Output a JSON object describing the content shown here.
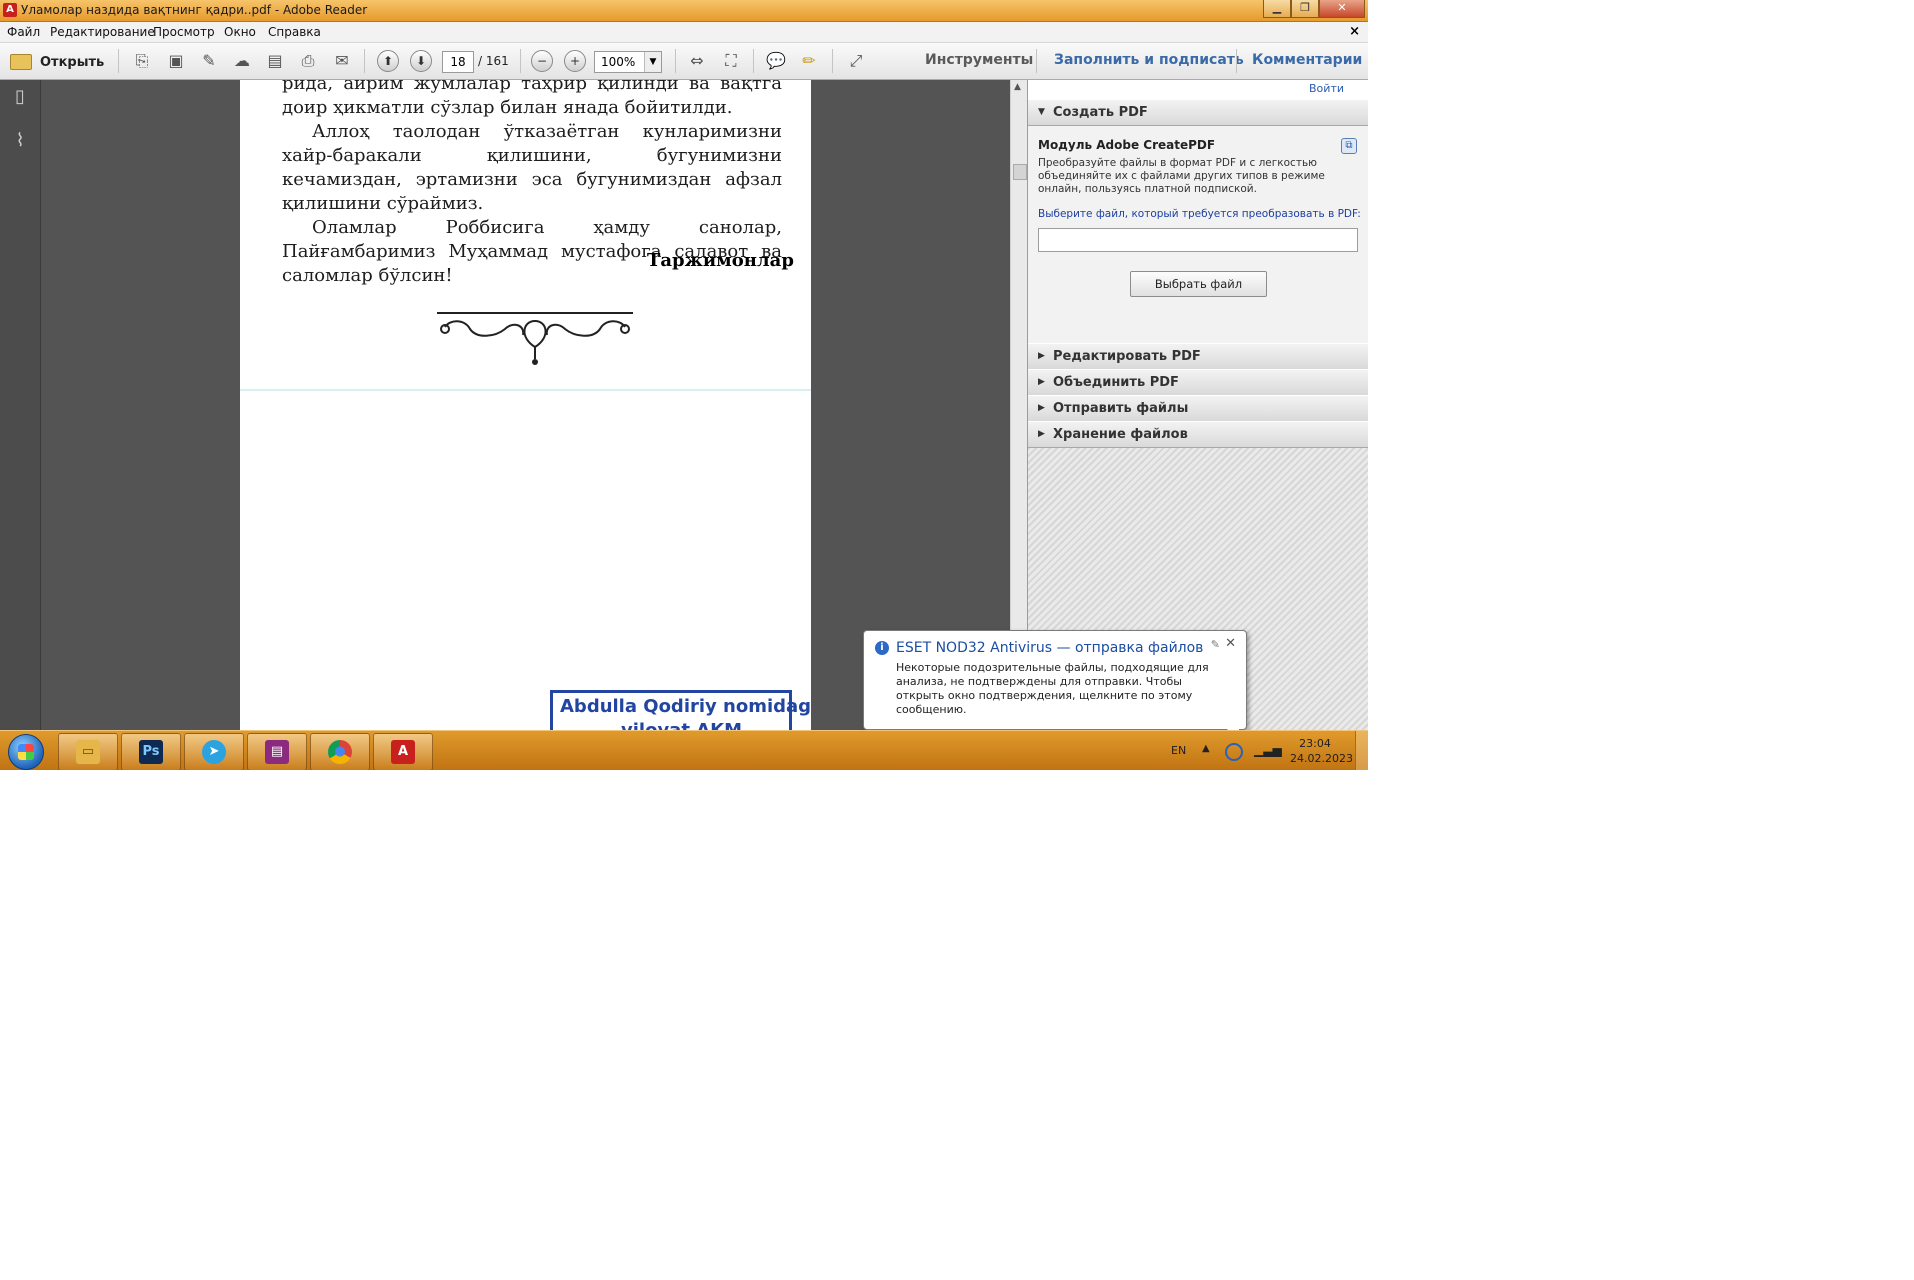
{
  "window": {
    "title": "Уламолар наздида вақтнинг қадри..pdf - Adobe Reader",
    "app_icon": "adobe-reader-icon"
  },
  "menu": [
    "Файл",
    "Редактирование",
    "Просмотр",
    "Окно",
    "Справка"
  ],
  "toolbar": {
    "open_label": "Открыть",
    "page_current": "18",
    "page_total": "/ 161",
    "zoom": "100%",
    "tools_label": "Инструменты",
    "fill_sign_label": "Заполнить и подписать",
    "comments_label": "Комментарии"
  },
  "document": {
    "paragraphs": [
      "рида, айрим жумлалар таҳрир қилинди ва вақтга доир ҳикматли сўзлар билан янада бойитилди.",
      "Аллоҳ таолодан ўтказаётган кунларимизни хайр-баракали қилишини, бугунимизни кечамиздан, эртамизни эса бугунимиздан афзал қилишини сўраймиз.",
      "Оламлар Роббисига ҳамду санолар, Пайғамбаримиз Муҳаммад мустафога салавот ва саломлар бўлсин!"
    ],
    "signature": "Таржимонлар",
    "stamp_line1": "Abdulla Qodiriy nomidagi",
    "stamp_line2": "viloyat AKM"
  },
  "panel": {
    "signin": "Войти",
    "create_pdf": "Создать PDF",
    "module_title": "Модуль Adobe CreatePDF",
    "module_desc": "Преобразуйте файлы в формат PDF и с легкостью объединяйте их с файлами других типов в режиме онлайн, пользуясь платной подпиской.",
    "choose_label": "Выберите файл, который требуется преобразовать в PDF:",
    "choose_button": "Выбрать файл",
    "sections": [
      "Редактировать PDF",
      "Объединить PDF",
      "Отправить файлы",
      "Хранение файлов"
    ]
  },
  "notification": {
    "title": "ESET NOD32 Antivirus — отправка файлов",
    "body": "Некоторые подозрительные файлы, подходящие для анализа, не подтверждены для отправки. Чтобы открыть окно подтверждения, щелкните по этому сообщению."
  },
  "taskbar": {
    "apps": [
      {
        "name": "explorer",
        "glyph": "▭",
        "color": "#e7b64a"
      },
      {
        "name": "photoshop",
        "glyph": "Ps",
        "color": "#0f2a52"
      },
      {
        "name": "telegram",
        "glyph": "➤",
        "color": "#2aa3e0"
      },
      {
        "name": "winrar",
        "glyph": "▤",
        "color": "#8b2a7e"
      },
      {
        "name": "chrome",
        "glyph": "●",
        "color": "#db4437"
      },
      {
        "name": "adobe-reader",
        "glyph": "A",
        "color": "#c8201c"
      }
    ],
    "lang": "EN",
    "time": "23:04",
    "date": "24.02.2023"
  }
}
